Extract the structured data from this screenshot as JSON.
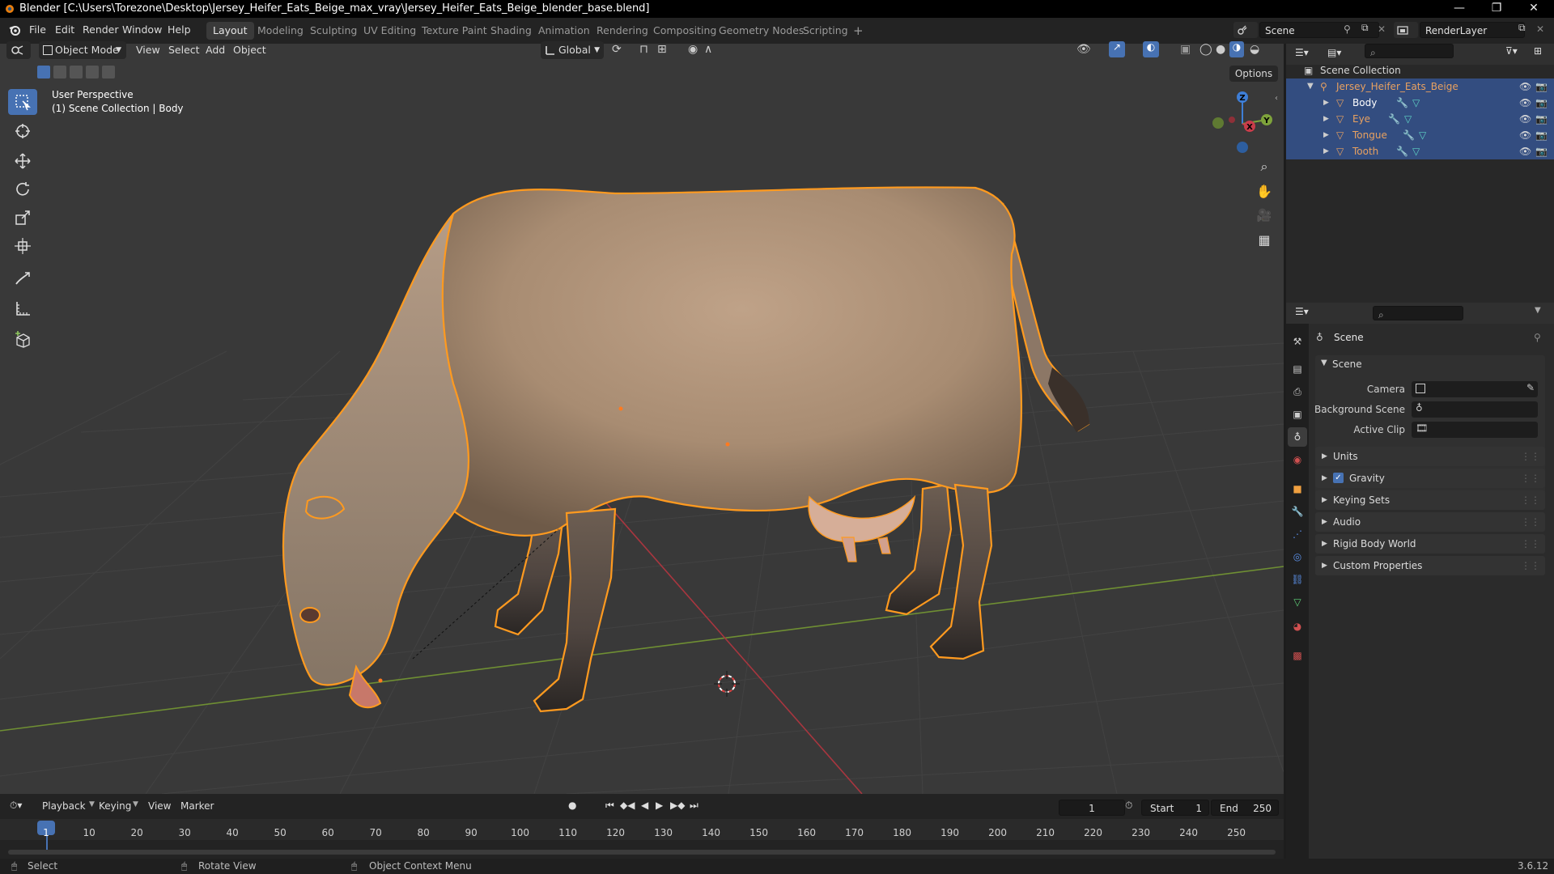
{
  "window": {
    "title": "Blender [C:\\Users\\Torezone\\Desktop\\Jersey_Heifer_Eats_Beige_max_vray\\Jersey_Heifer_Eats_Beige_blender_base.blend]",
    "controls": [
      "—",
      "❐",
      "✕"
    ]
  },
  "menubar": {
    "items": [
      "File",
      "Edit",
      "Render",
      "Window",
      "Help"
    ]
  },
  "workspaces": {
    "tabs": [
      "Layout",
      "Modeling",
      "Sculpting",
      "UV Editing",
      "Texture Paint",
      "Shading",
      "Animation",
      "Rendering",
      "Compositing",
      "Geometry Nodes",
      "Scripting"
    ],
    "active": "Layout",
    "add": "+"
  },
  "scene_selector": {
    "value": "Scene"
  },
  "renderlayer_selector": {
    "value": "RenderLayer"
  },
  "viewport_header": {
    "mode": "Object Mode",
    "menus": [
      "View",
      "Select",
      "Add",
      "Object"
    ],
    "orientation": "Global",
    "options": "Options"
  },
  "viewport_overlay": {
    "perspective": "User Perspective",
    "context": "(1) Scene Collection | Body"
  },
  "gizmo": {
    "x": "X",
    "y": "Y",
    "z": "Z"
  },
  "outliner": {
    "root": "Scene Collection",
    "collection": "Jersey_Heifer_Eats_Beige",
    "objects": [
      "Body",
      "Eye",
      "Tongue",
      "Tooth"
    ]
  },
  "properties": {
    "header": "Scene",
    "panel": "Scene",
    "fields": [
      {
        "label": "Camera",
        "value": ""
      },
      {
        "label": "Background Scene",
        "value": ""
      },
      {
        "label": "Active Clip",
        "value": ""
      }
    ],
    "sections": [
      "Units",
      "Gravity",
      "Keying Sets",
      "Audio",
      "Rigid Body World",
      "Custom Properties"
    ],
    "gravity_checked": true
  },
  "timeline": {
    "menus": [
      "Playback",
      "Keying",
      "View",
      "Marker"
    ],
    "current_frame": "1",
    "start_label": "Start",
    "start": "1",
    "end_label": "End",
    "end": "250",
    "ticks": [
      "1",
      "10",
      "20",
      "30",
      "40",
      "50",
      "60",
      "70",
      "80",
      "90",
      "100",
      "110",
      "120",
      "130",
      "140",
      "150",
      "160",
      "170",
      "180",
      "190",
      "200",
      "210",
      "220",
      "230",
      "240",
      "250"
    ]
  },
  "statusbar": {
    "items": [
      "Select",
      "Rotate View",
      "Object Context Menu"
    ],
    "version": "3.6.12"
  },
  "colors": {
    "selection_outline": "#ff9a1f",
    "active_blue": "#4772b3",
    "x_axis": "#c83c4a",
    "y_axis": "#7ea33b",
    "z_axis": "#3e7ed6"
  }
}
